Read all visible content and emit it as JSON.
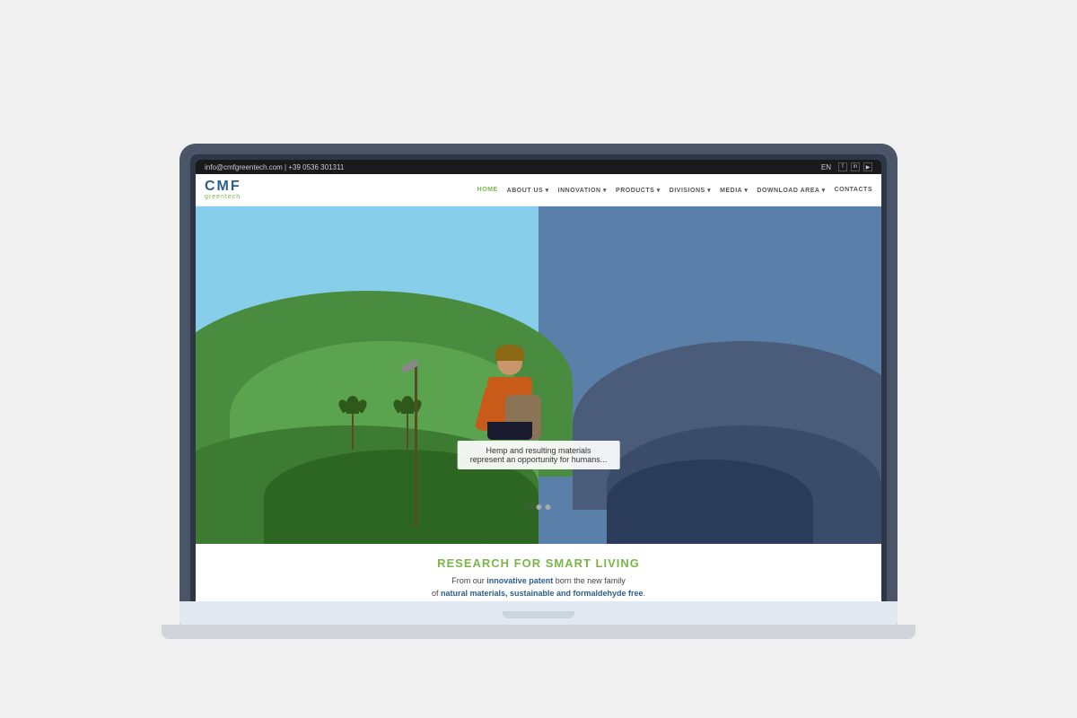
{
  "topbar": {
    "contact": "info@cmfgreentech.com | +39 0536 301311",
    "lang": "EN",
    "social": [
      "f",
      "in",
      "▶"
    ]
  },
  "nav": {
    "logo_cmf": "CMF",
    "logo_sub": "greentech",
    "links": [
      {
        "label": "HOME",
        "active": true
      },
      {
        "label": "ABOUT US ▾",
        "active": false
      },
      {
        "label": "INNOVATION ▾",
        "active": false
      },
      {
        "label": "PRODUCTS ▾",
        "active": false
      },
      {
        "label": "DIVISIONS ▾",
        "active": false
      },
      {
        "label": "MEDIA ▾",
        "active": false
      },
      {
        "label": "DOWNLOAD AREA ▾",
        "active": false
      },
      {
        "label": "CONTACTS",
        "active": false
      }
    ]
  },
  "hero": {
    "text_line1": "Hemp and resulting materials",
    "text_line2": "represent an opportunity for humans...",
    "slider_dots": 3
  },
  "section": {
    "title": "RESEARCH FOR SMART LIVING",
    "subtitle_plain1": "From our ",
    "subtitle_bold": "innovative patent",
    "subtitle_plain2": " born the new family",
    "subtitle_line2_plain": "of ",
    "subtitle_line2_bold": "natural materials, sustainable and formaldehyde free",
    "subtitle_line2_end": "."
  }
}
